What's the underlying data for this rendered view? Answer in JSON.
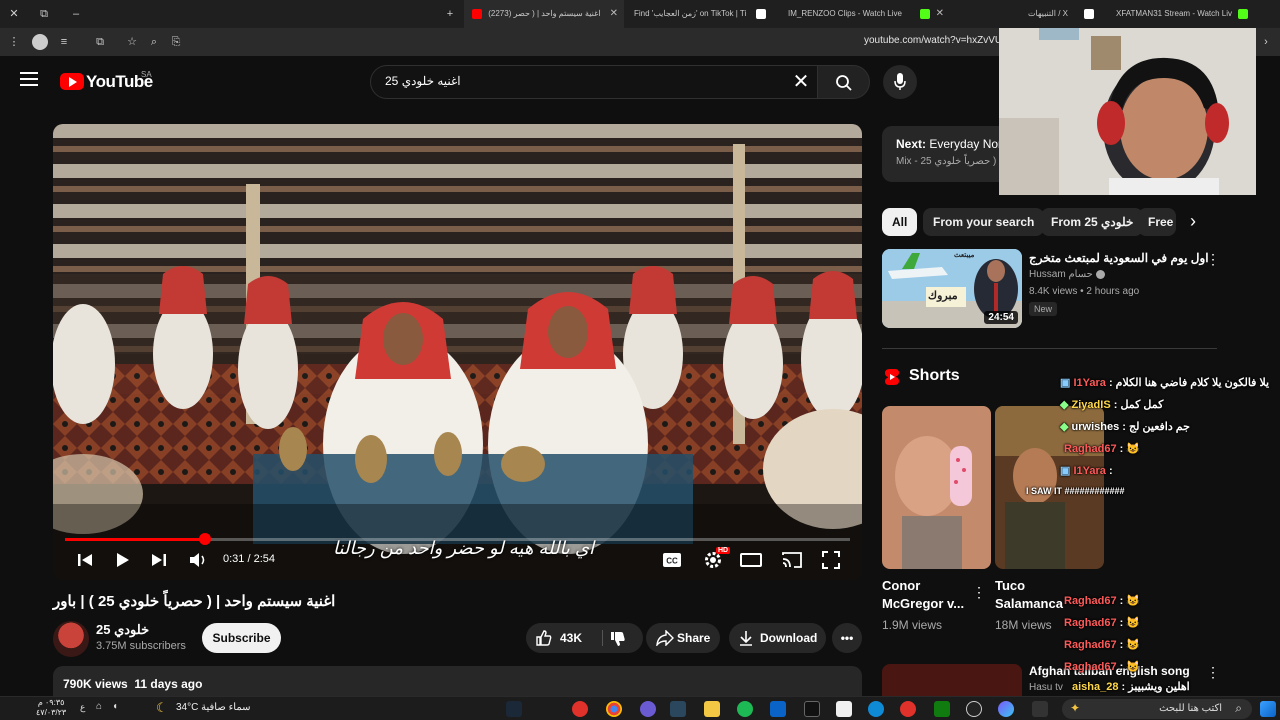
{
  "browser": {
    "tabs": [
      {
        "title": "(2273) اغنية سيستم واحد | ( حصر",
        "favicon_color": "#ff0000"
      },
      {
        "title": "Find 'زمن العجايب' on TikTok | Ti",
        "favicon_color": "#ffffff"
      },
      {
        "title": "IM_RENZOO Clips - Watch Live",
        "favicon_color": "#53fc18"
      },
      {
        "title": "التنبيهات / X",
        "favicon_color": "#ffffff"
      },
      {
        "title": "XFATMAN31 Stream - Watch Liv",
        "favicon_color": "#53fc18"
      }
    ],
    "url": "youtube.com/watch?v=hxZvVUar"
  },
  "youtube": {
    "logo_text": "YouTube",
    "country_code": "SA",
    "search_query": "اغنيه خلودي 25",
    "player": {
      "time_current": "0:31",
      "time_total": "2:54",
      "progress": 0.178,
      "subtitle": "اي بالله هيه لو حضر واحد من رجالنا",
      "hd_badge": "HD"
    },
    "video": {
      "title": "اغنية سيستم واحد | ( حصرياً خلودي 25 ) | باور",
      "channel_name": "خلودي 25",
      "subscribers": "3.75M subscribers",
      "subscribe_label": "Subscribe",
      "likes": "43K",
      "share_label": "Share",
      "download_label": "Download",
      "views": "790K views",
      "age": "11 days ago"
    },
    "next": {
      "label": "Next:",
      "title": "Everyday Norm",
      "subtitle": "Mix - باور | ( حصرياً خلودي 25"
    },
    "chips": [
      "All",
      "From your search",
      "From خلودي 25",
      "Free"
    ],
    "recommended": {
      "title": "اول يوم في السعودية لمبتعث متخرج",
      "channel": "Hussam حسام",
      "meta": "8.4K views • 2 hours ago",
      "badge": "New",
      "duration": "24:54",
      "thumb_text": "مبروك",
      "thumb_sign": "ميبتعث"
    },
    "shorts_label": "Shorts",
    "shorts": [
      {
        "title": "Conor McGregor v...",
        "views": "1.9M views"
      },
      {
        "title": "Tuco Salamanca",
        "views": "18M views"
      }
    ],
    "bottom_rec_title": "Afghan taliban english song",
    "bottom_rec_channel": "Hasu tv"
  },
  "chat": [
    {
      "user": "I1Yara",
      "msg": "يلا فالكون يلا كلام فاضي هنا الكلام",
      "color": "red"
    },
    {
      "user": "ZiyadIS",
      "msg": "كمل كمل",
      "color": "yellow"
    },
    {
      "user": "urwishes",
      "msg": "جم دافعين لج",
      "color": "white"
    },
    {
      "user": "Raghad67",
      "msg": "😺",
      "color": "red"
    },
    {
      "user": "I1Yara",
      "msg": "",
      "color": "red"
    },
    {
      "user": "",
      "msg": "I SAW IT ############",
      "color": "white"
    },
    {
      "user": "Raghad67",
      "msg": "😺",
      "color": "red"
    },
    {
      "user": "Raghad67",
      "msg": "😺",
      "color": "red"
    },
    {
      "user": "Raghad67",
      "msg": "😺",
      "color": "red"
    },
    {
      "user": "Raghad67",
      "msg": "😺",
      "color": "red"
    },
    {
      "user": "aisha_28",
      "msg": "اهلين ويشبيبز",
      "color": "yellow"
    }
  ],
  "taskbar": {
    "search_placeholder": "اكتب هنا للبحث",
    "weather": "34°C سماء صافية",
    "time": "٠٩:٣٥ م",
    "date": "٤٧/٠٣/٢٣"
  }
}
